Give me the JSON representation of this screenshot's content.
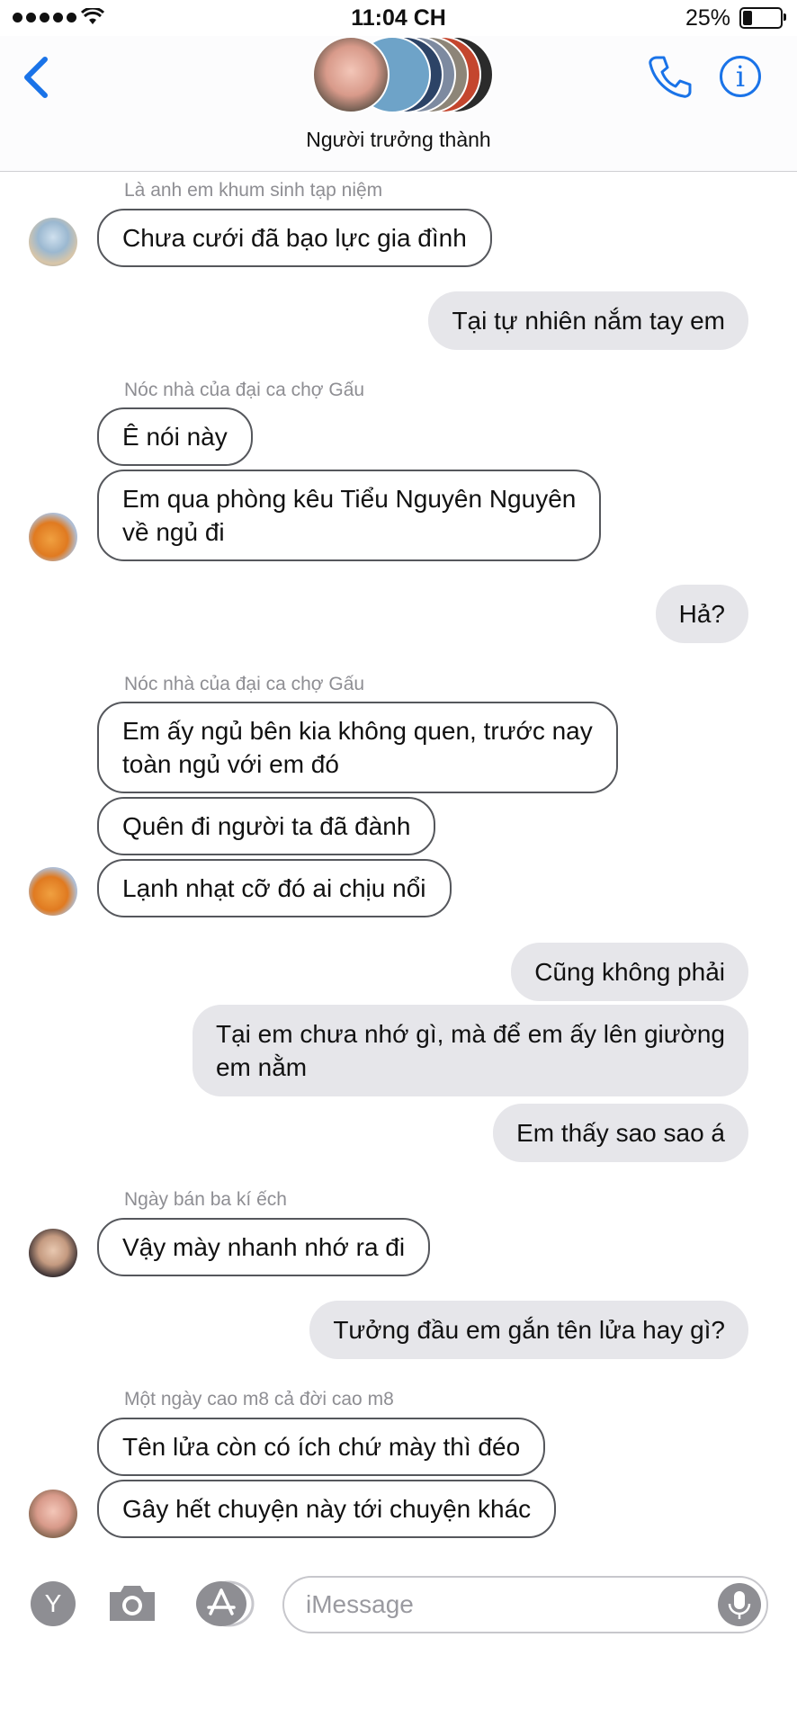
{
  "status_bar": {
    "time": "11:04 CH",
    "battery_percent": "25%",
    "battery_level": 0.25
  },
  "header": {
    "group_name": "Người trưởng thành"
  },
  "messages": [
    {
      "dir": "in",
      "sender": "Là anh em khum sinh tạp niệm",
      "lines": [
        "Chưa cưới đã bạo lực gia đình"
      ]
    },
    {
      "dir": "out",
      "lines": [
        "Tại tự nhiên nắm tay em"
      ]
    },
    {
      "dir": "in",
      "sender": "Nóc nhà của đại ca chợ Gấu",
      "lines": [
        "Ê nói này"
      ]
    },
    {
      "dir": "in",
      "lines": [
        "Em qua phòng kêu Tiểu Nguyên Nguyên",
        "về ngủ đi"
      ]
    },
    {
      "dir": "out",
      "lines": [
        "Hả?"
      ]
    },
    {
      "dir": "in",
      "sender": "Nóc nhà của đại ca chợ Gấu",
      "lines": [
        "Em ấy ngủ bên kia không quen, trước nay",
        "toàn ngủ với em đó"
      ]
    },
    {
      "dir": "in",
      "lines": [
        "Quên đi người ta đã đành"
      ]
    },
    {
      "dir": "in",
      "lines": [
        "Lạnh nhạt cỡ đó ai chịu nổi"
      ]
    },
    {
      "dir": "out",
      "lines": [
        "Cũng không phải"
      ]
    },
    {
      "dir": "out",
      "lines": [
        "Tại em chưa nhớ gì, mà để em ấy lên giường",
        "em nằm"
      ]
    },
    {
      "dir": "out",
      "lines": [
        "Em thấy sao sao á"
      ]
    },
    {
      "dir": "in",
      "sender": "Ngày bán ba kí ếch",
      "lines": [
        "Vậy mày nhanh nhớ ra đi"
      ]
    },
    {
      "dir": "out",
      "lines": [
        "Tưởng đầu em gắn tên lửa hay gì?"
      ]
    },
    {
      "dir": "in",
      "sender": "Một ngày cao m8 cả đời cao m8",
      "lines": [
        "Tên lửa còn có ích chứ mày thì đéo"
      ]
    },
    {
      "dir": "in",
      "lines": [
        "Gây hết chuyện này tới chuyện khác"
      ]
    }
  ],
  "composer": {
    "app_button_letter": "Y",
    "placeholder": "iMessage",
    "icons": [
      "y-icon",
      "camera-icon",
      "app-store-icon",
      "microphone-icon"
    ]
  },
  "colors": {
    "accent": "#1a73e8",
    "outgoing_bubble": "#e6e6ea",
    "incoming_border": "#55575c"
  }
}
